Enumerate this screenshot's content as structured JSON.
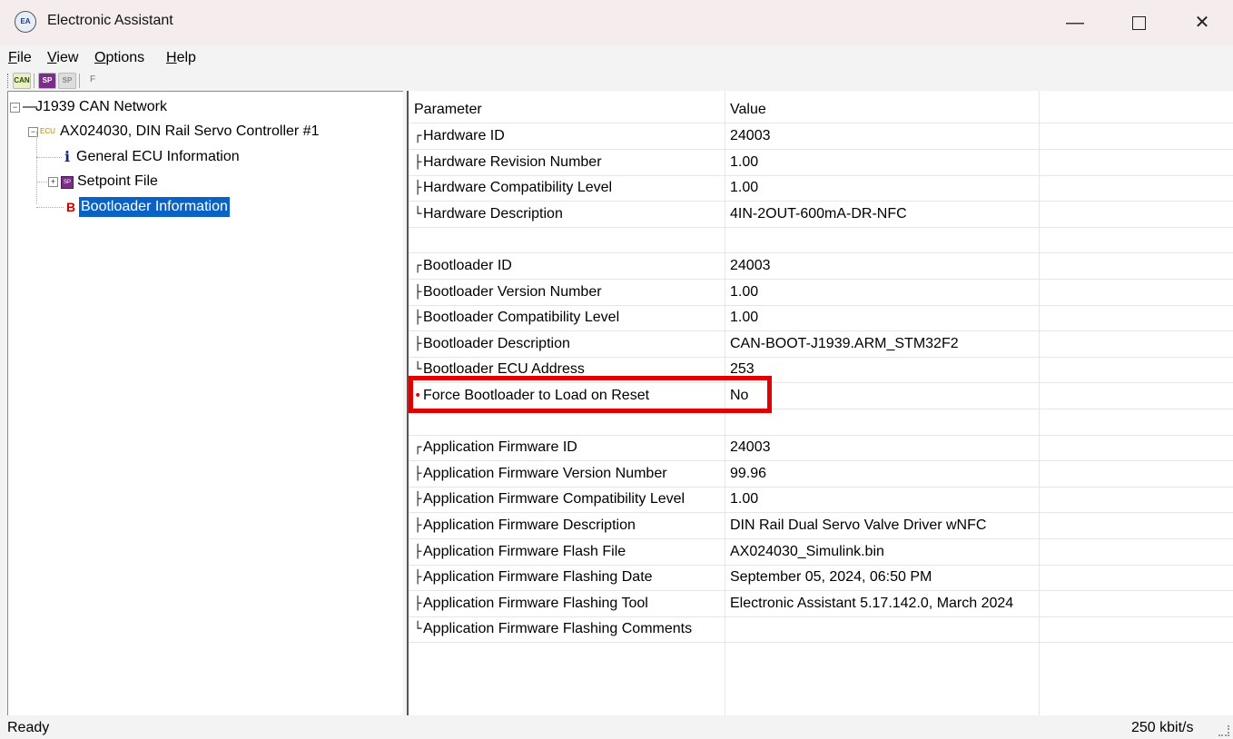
{
  "window": {
    "title": "Electronic Assistant",
    "app_icon": "EA",
    "minimize": "—",
    "close": "✕"
  },
  "menu": {
    "file": "File",
    "view": "View",
    "options": "Options",
    "help": "Help"
  },
  "toolbar": {
    "can": "CAN",
    "sp1": "SP",
    "sp2": "SP",
    "f": "F"
  },
  "tree": {
    "root": "J1939 CAN Network",
    "ecu_badge": "ECU",
    "ecu": "AX024030, DIN Rail Servo Controller #1",
    "info_glyph": "i",
    "general": "General ECU Information",
    "sp_badge": "SP",
    "setpoint": "Setpoint File",
    "b_glyph": "B",
    "bootloader": "Bootloader Information"
  },
  "grid": {
    "headers": {
      "param": "Parameter",
      "value": "Value"
    },
    "rows": [
      {
        "b": "┌",
        "p": "Hardware ID",
        "v": "24003"
      },
      {
        "b": "├",
        "p": "Hardware Revision Number",
        "v": "1.00"
      },
      {
        "b": "├",
        "p": "Hardware Compatibility Level",
        "v": "1.00"
      },
      {
        "b": "└",
        "p": "Hardware Description",
        "v": "4IN-2OUT-600mA-DR-NFC"
      },
      {
        "b": "",
        "p": "",
        "v": ""
      },
      {
        "b": "┌",
        "p": "Bootloader ID",
        "v": "24003"
      },
      {
        "b": "├",
        "p": "Bootloader Version Number",
        "v": "1.00"
      },
      {
        "b": "├",
        "p": "Bootloader Compatibility Level",
        "v": "1.00"
      },
      {
        "b": "├",
        "p": "Bootloader Description",
        "v": "CAN-BOOT-J1939.ARM_STM32F2"
      },
      {
        "b": "└",
        "p": "Bootloader ECU Address",
        "v": "253"
      },
      {
        "b": "•",
        "p": "Force Bootloader to Load on Reset",
        "v": "No"
      },
      {
        "b": "",
        "p": "",
        "v": ""
      },
      {
        "b": "┌",
        "p": "Application Firmware ID",
        "v": "24003"
      },
      {
        "b": "├",
        "p": "Application Firmware Version Number",
        "v": "99.96"
      },
      {
        "b": "├",
        "p": "Application Firmware Compatibility Level",
        "v": "1.00"
      },
      {
        "b": "├",
        "p": "Application Firmware Description",
        "v": "DIN Rail Dual Servo Valve Driver wNFC"
      },
      {
        "b": "├",
        "p": "Application Firmware Flash File",
        "v": "AX024030_Simulink.bin"
      },
      {
        "b": "├",
        "p": "Application Firmware Flashing Date",
        "v": "September 05, 2024, 06:50 PM"
      },
      {
        "b": "├",
        "p": "Application Firmware Flashing Tool",
        "v": "Electronic Assistant 5.17.142.0, March 2024"
      },
      {
        "b": "└",
        "p": "Application Firmware Flashing Comments",
        "v": ""
      }
    ]
  },
  "status": {
    "left": "Ready",
    "right": "250 kbit/s"
  },
  "colors": {
    "selection": "#0a62c4",
    "highlight": "#e00000",
    "bullet": "#e00000"
  }
}
